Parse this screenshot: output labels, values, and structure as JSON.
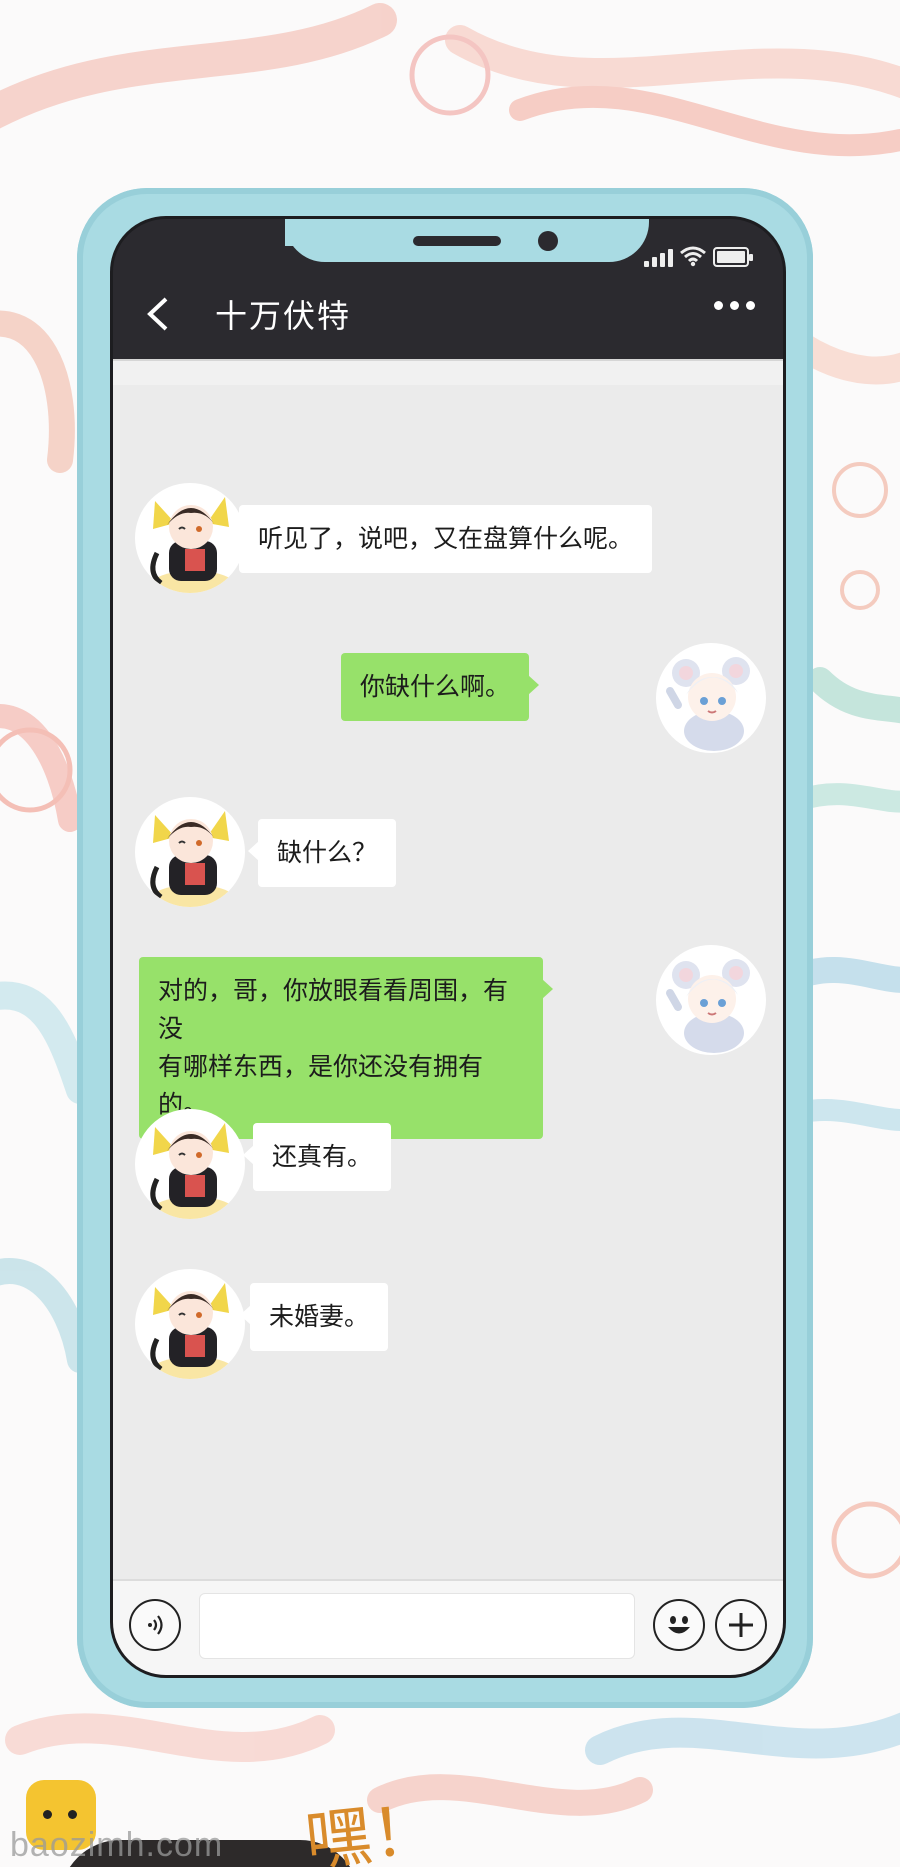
{
  "status_bar": {
    "icons": [
      "signal-icon",
      "wifi-icon",
      "battery-icon"
    ]
  },
  "header": {
    "back_icon": "chevron-left-icon",
    "title": "十万伏特",
    "more_icon": "more-dots-icon"
  },
  "messages": [
    {
      "side": "left",
      "avatar": "boy-black-hair-avatar",
      "text": "听见了，说吧，又在盘算什么呢。"
    },
    {
      "side": "right",
      "avatar": "white-hair-mouse-avatar",
      "text": "你缺什么啊。"
    },
    {
      "side": "left",
      "avatar": "boy-black-hair-avatar",
      "text": "缺什么？"
    },
    {
      "side": "right",
      "avatar": "white-hair-mouse-avatar",
      "text": "对的，哥，你放眼看看周围，有没有哪样东西，是你还没有拥有的。",
      "line1": "对的，哥，你放眼看看周围，有没",
      "line2": "有哪样东西，是你还没有拥有的。"
    },
    {
      "side": "left",
      "avatar": "boy-black-hair-avatar",
      "text": "还真有。"
    },
    {
      "side": "left",
      "avatar": "boy-black-hair-avatar",
      "text": "未婚妻。"
    }
  ],
  "input_bar": {
    "voice_icon": "voice-icon",
    "emoji_icon": "emoji-icon",
    "plus_icon": "plus-icon",
    "text_value": ""
  },
  "watermark": {
    "site": "baozimh.com",
    "sfx": "嘿！"
  },
  "colors": {
    "phone_frame": "#a9dbe3",
    "screen_header": "#2b2a2f",
    "chat_background": "#ebebeb",
    "bubble_incoming": "#ffffff",
    "bubble_outgoing": "#97e16a"
  }
}
